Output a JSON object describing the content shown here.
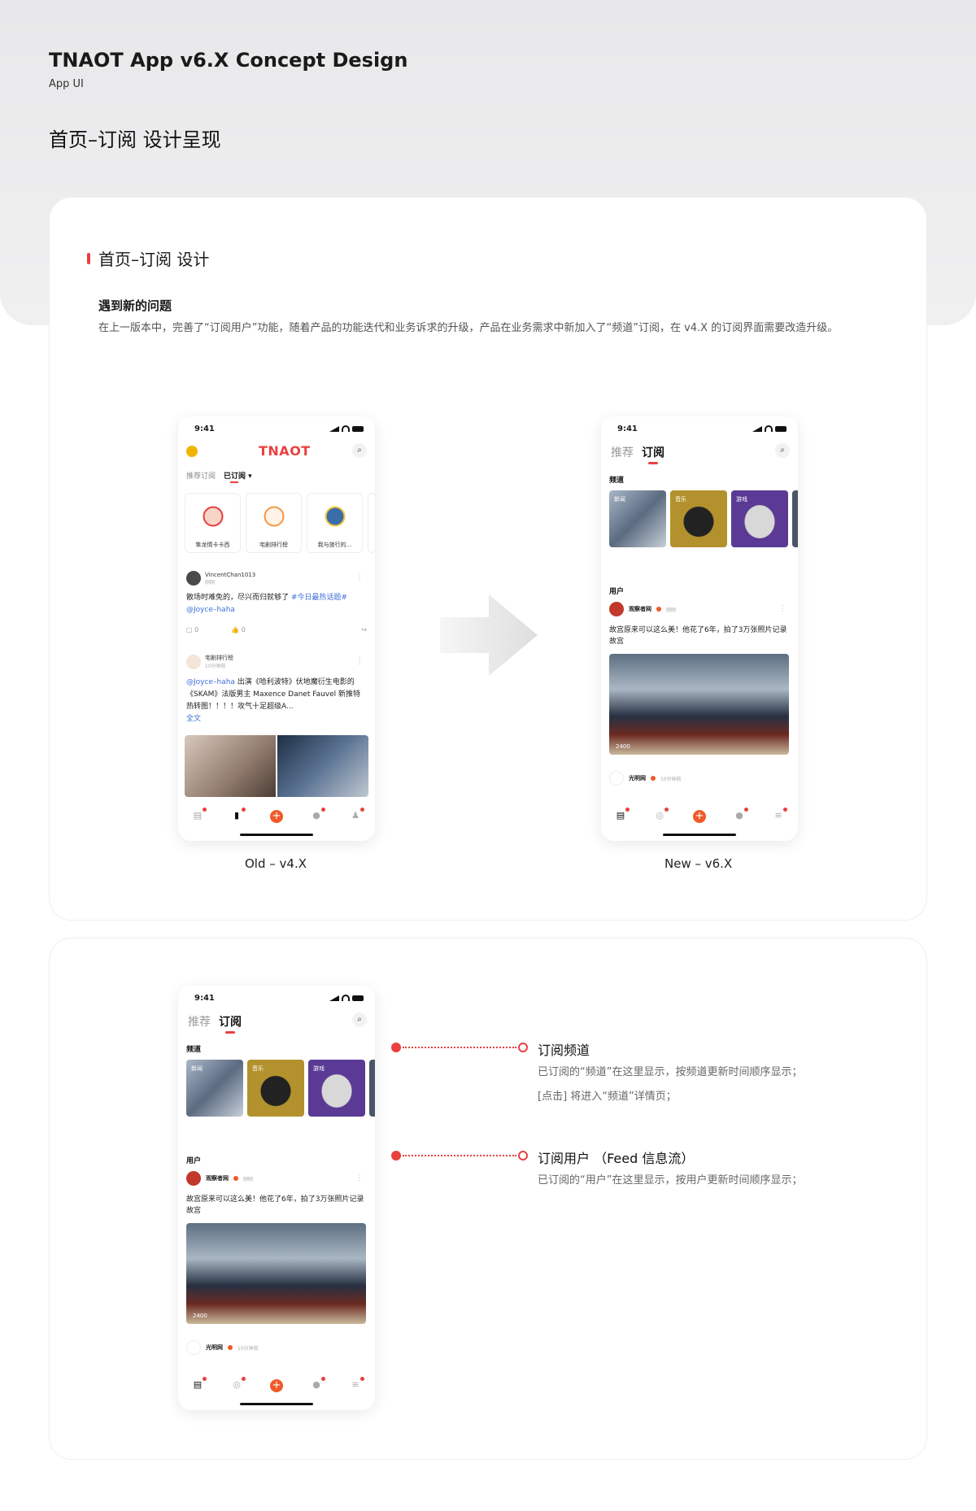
{
  "header": {
    "title": "TNAOT App v6.X Concept Design",
    "subtitle": "App UI",
    "section": "首页–订阅 设计呈现"
  },
  "card1": {
    "heading": "首页–订阅 设计",
    "issue_title": "遇到新的问题",
    "issue_text": "在上一版本中，完善了“订阅用户”功能，随着产品的功能迭代和业务诉求的升级，产品在业务需求中新加入了“频道”订阅，在 v4.X 的订阅界面需要改造升级。",
    "caption_old": "Old – v4.X",
    "caption_new": "New – v6.X"
  },
  "phone_common": {
    "time": "9:41"
  },
  "old_phone": {
    "logo": "TNAOT",
    "tabs": [
      "推荐订阅",
      "已订阅 ▾"
    ],
    "channels": [
      "隼龙情卡卡西",
      "宅剧排行榜",
      "我与旅行的..."
    ],
    "post1": {
      "user": "VincentChan1013",
      "time": "刚刚",
      "text": "散场时难免的，尽兴而归就够了",
      "tag": "#今日最热话题#",
      "mention": "@Joyce–haha",
      "comments": "0",
      "likes": "0"
    },
    "post2": {
      "user": "宅剧排行榜",
      "time": "10分钟前",
      "mention": "@Joyce–haha",
      "text": " 出演《哈利波特》伏地魔衍生电影的《SKAM》法版男主 Maxence Danet Fauvel 新推特热转图！！！！攻气十足超级A...",
      "more": "全文"
    }
  },
  "new_phone": {
    "tabs": [
      "推荐",
      "订阅"
    ],
    "channels_label": "频道",
    "channels": [
      "新闻",
      "音乐",
      "游戏"
    ],
    "users_label": "用户",
    "pub1": {
      "name": "观察者网",
      "time": "刚刚"
    },
    "article": "故宫原来可以这么美！他花了6年，拍了3万张照片记录故宫",
    "views": "2400",
    "pub2": {
      "name": "光明网",
      "time": "10分钟前"
    }
  },
  "features": [
    {
      "title": "订阅频道",
      "desc": [
        "已订阅的“频道”在这里显示，按频道更新时间顺序显示；",
        "[点击] 将进入“频道”详情页；"
      ]
    },
    {
      "title": "订阅用户 （Feed 信息流）",
      "desc": [
        "已订阅的“用户”在这里显示，按用户更新时间顺序显示；"
      ]
    }
  ],
  "colors": {
    "accent": "#e94040",
    "plus": "#f05a28"
  }
}
